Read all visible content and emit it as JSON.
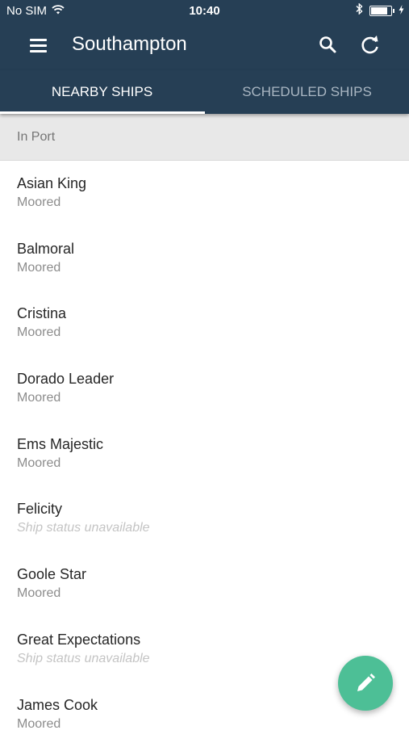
{
  "status_bar": {
    "carrier": "No SIM",
    "time": "10:40",
    "battery_level": 0.9
  },
  "app_bar": {
    "title": "Southampton",
    "icons": [
      "menu-icon",
      "search-icon",
      "refresh-icon"
    ]
  },
  "tabs": [
    {
      "label": "NEARBY SHIPS",
      "active": true
    },
    {
      "label": "SCHEDULED SHIPS",
      "active": false
    }
  ],
  "section": {
    "title": "In Port"
  },
  "ships": [
    {
      "name": "Asian King",
      "status": "Moored"
    },
    {
      "name": "Balmoral",
      "status": "Moored"
    },
    {
      "name": "Cristina",
      "status": "Moored"
    },
    {
      "name": "Dorado Leader",
      "status": "Moored"
    },
    {
      "name": "Ems Majestic",
      "status": "Moored"
    },
    {
      "name": "Felicity",
      "status": "Ship status unavailable"
    },
    {
      "name": "Goole Star",
      "status": "Moored"
    },
    {
      "name": "Great Expectations",
      "status": "Ship status unavailable"
    },
    {
      "name": "James Cook",
      "status": "Moored"
    }
  ],
  "fab": {
    "icon": "pencil-icon"
  },
  "colors": {
    "primary": "#263f55",
    "accent": "#4dbf96",
    "tab_inactive": "#a9b6c2",
    "section_bg": "#e8e8e8"
  }
}
